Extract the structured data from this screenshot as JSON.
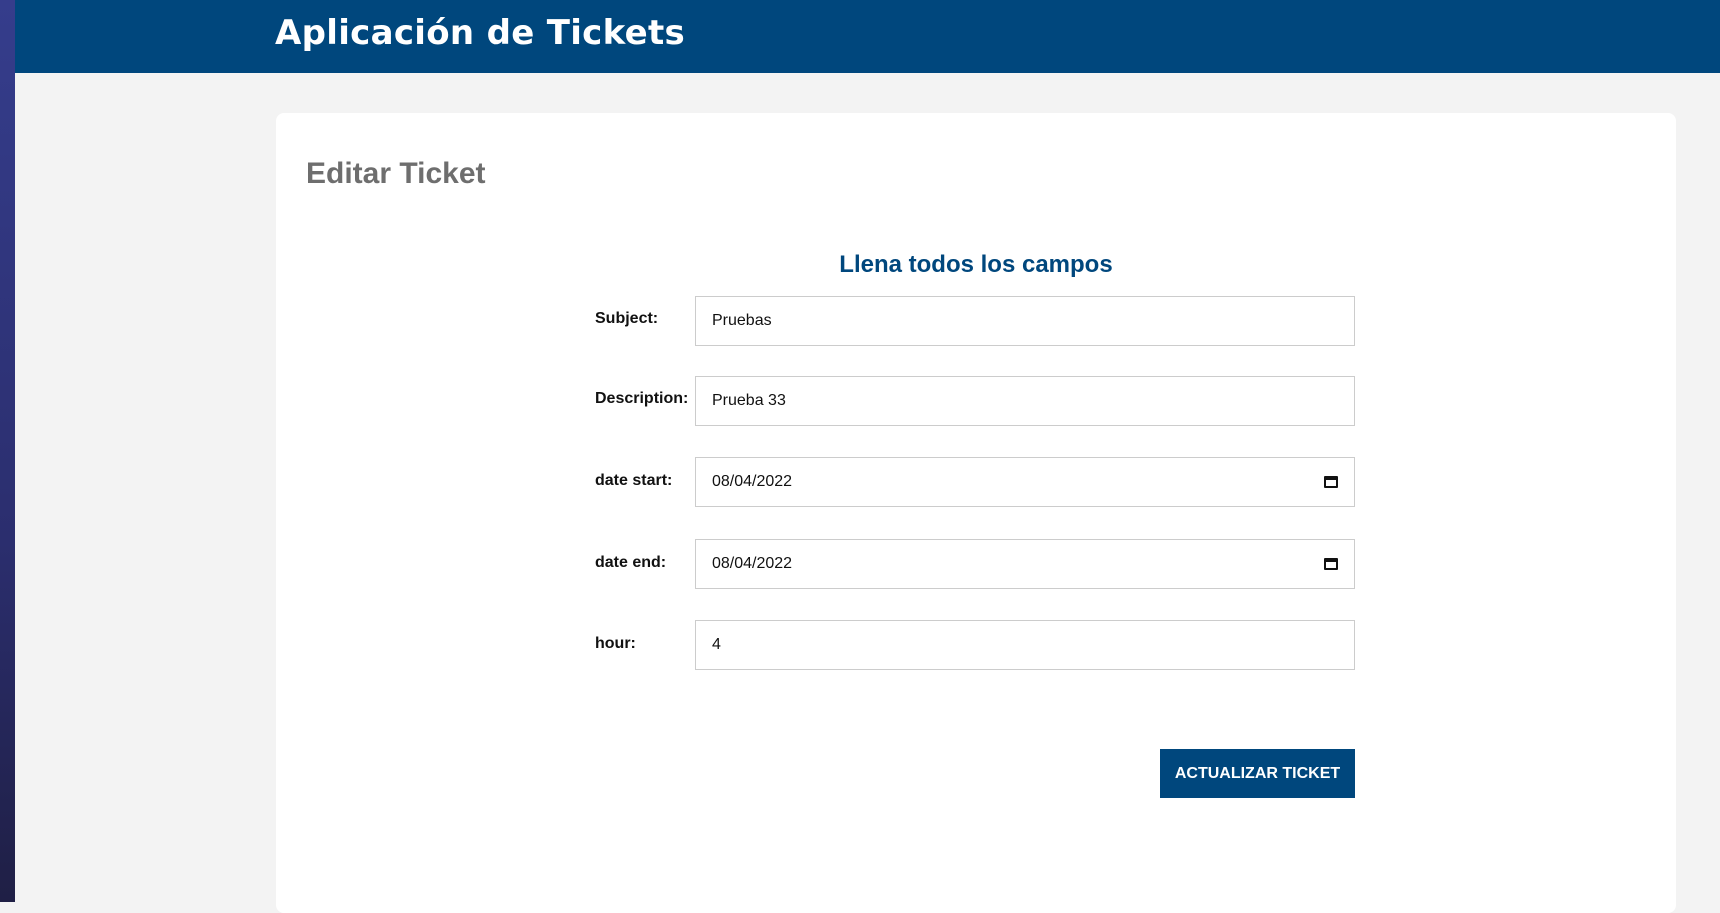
{
  "header": {
    "title": "Aplicación de Tickets"
  },
  "page": {
    "title": "Editar Ticket"
  },
  "form": {
    "heading": "Llena todos los campos",
    "fields": [
      {
        "label": "Subject:",
        "value": "Pruebas"
      },
      {
        "label": "Description:",
        "value": "Prueba 33"
      },
      {
        "label": "date start:",
        "value": "08/04/2022",
        "icon": "calendar-icon"
      },
      {
        "label": "date end:",
        "value": "08/04/2022",
        "icon": "calendar-icon"
      },
      {
        "label": "hour:",
        "value": "4"
      }
    ],
    "submit_label": "ACTUALIZAR TICKET"
  },
  "colors": {
    "brand": "#00477d",
    "background": "#f3f3f3",
    "card": "#ffffff",
    "page_title": "#6e6e6e"
  }
}
